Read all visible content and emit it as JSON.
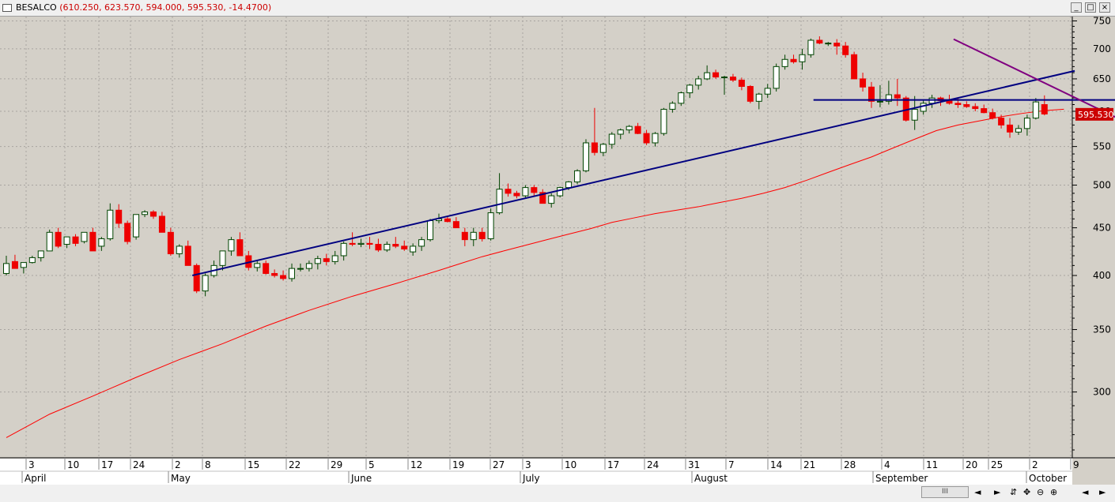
{
  "window": {
    "symbol": "BESALCO",
    "values": "(610.250, 623.570, 594.000, 595.530, -14.4700)",
    "buttons": [
      "_",
      "□",
      "×"
    ]
  },
  "colors": {
    "up_fill": "#ffffff",
    "up_stroke": "#004400",
    "down": "#ee0000",
    "ma": "#ff0000",
    "trend": "#000080",
    "down_trend": "#800080",
    "bg": "#d4d0c8",
    "price_box": "#cc0000"
  },
  "scrollbar": {
    "thumb_label": "III",
    "icons": [
      "◄",
      "►",
      "⇵",
      "✥",
      "⊖",
      "⊕",
      "◄",
      "►"
    ]
  },
  "chart_data": {
    "type": "candlestick",
    "y_axis": {
      "scale": "log",
      "range": [
        255,
        770
      ],
      "ticks": [
        300,
        350,
        400,
        450,
        500,
        550,
        600,
        650,
        700,
        750
      ]
    },
    "last_price_label": "595.530",
    "day_labels": [
      "3",
      "10",
      "17",
      "24",
      "2",
      "8",
      "15",
      "22",
      "29",
      "5",
      "12",
      "19",
      "27",
      "3",
      "10",
      "17",
      "24",
      "31",
      "7",
      "14",
      "21",
      "28",
      "4",
      "11",
      "20",
      "25",
      "2",
      "9"
    ],
    "month_labels": [
      "April",
      "May",
      "June",
      "July",
      "August",
      "September",
      "October"
    ],
    "candles": [
      [
        402,
        420,
        400,
        412
      ],
      [
        414,
        421,
        407,
        407
      ],
      [
        408,
        413,
        402,
        413
      ],
      [
        413,
        420,
        412,
        418
      ],
      [
        418,
        425,
        414,
        425
      ],
      [
        425,
        448,
        425,
        445
      ],
      [
        445,
        450,
        428,
        430
      ],
      [
        432,
        440,
        428,
        440
      ],
      [
        440,
        443,
        430,
        433
      ],
      [
        435,
        445,
        433,
        445
      ],
      [
        445,
        450,
        425,
        425
      ],
      [
        430,
        440,
        425,
        438
      ],
      [
        438,
        478,
        436,
        470
      ],
      [
        470,
        477,
        450,
        455
      ],
      [
        455,
        458,
        432,
        435
      ],
      [
        440,
        465,
        437,
        465
      ],
      [
        465,
        470,
        462,
        468
      ],
      [
        468,
        470,
        460,
        463
      ],
      [
        463,
        468,
        445,
        445
      ],
      [
        445,
        450,
        420,
        422
      ],
      [
        422,
        432,
        418,
        430
      ],
      [
        430,
        436,
        410,
        410
      ],
      [
        410,
        412,
        383,
        385
      ],
      [
        385,
        402,
        380,
        400
      ],
      [
        400,
        415,
        398,
        410
      ],
      [
        410,
        425,
        405,
        425
      ],
      [
        425,
        440,
        420,
        437
      ],
      [
        437,
        445,
        420,
        420
      ],
      [
        420,
        425,
        405,
        408
      ],
      [
        408,
        415,
        404,
        412
      ],
      [
        412,
        415,
        401,
        402
      ],
      [
        402,
        406,
        398,
        400
      ],
      [
        400,
        405,
        395,
        397
      ],
      [
        397,
        412,
        394,
        407
      ],
      [
        407,
        412,
        404,
        407
      ],
      [
        407,
        415,
        404,
        412
      ],
      [
        412,
        420,
        406,
        417
      ],
      [
        417,
        422,
        410,
        414
      ],
      [
        414,
        425,
        411,
        420
      ],
      [
        420,
        435,
        415,
        433
      ],
      [
        433,
        445,
        430,
        432
      ],
      [
        432,
        438,
        429,
        433
      ],
      [
        433,
        440,
        427,
        432
      ],
      [
        432,
        438,
        424,
        426
      ],
      [
        426,
        435,
        424,
        432
      ],
      [
        432,
        440,
        428,
        430
      ],
      [
        430,
        436,
        425,
        427
      ],
      [
        424,
        433,
        420,
        430
      ],
      [
        430,
        440,
        425,
        437
      ],
      [
        437,
        460,
        435,
        458
      ],
      [
        458,
        466,
        455,
        460
      ],
      [
        460,
        463,
        456,
        457
      ],
      [
        457,
        462,
        450,
        450
      ],
      [
        445,
        450,
        430,
        437
      ],
      [
        437,
        450,
        430,
        445
      ],
      [
        445,
        450,
        435,
        438
      ],
      [
        438,
        472,
        436,
        467
      ],
      [
        467,
        515,
        465,
        495
      ],
      [
        495,
        502,
        486,
        490
      ],
      [
        490,
        493,
        484,
        487
      ],
      [
        487,
        500,
        485,
        497
      ],
      [
        497,
        500,
        486,
        491
      ],
      [
        491,
        495,
        478,
        478
      ],
      [
        478,
        490,
        473,
        487
      ],
      [
        487,
        498,
        485,
        497
      ],
      [
        497,
        505,
        494,
        504
      ],
      [
        504,
        520,
        501,
        518
      ],
      [
        518,
        560,
        516,
        555
      ],
      [
        555,
        605,
        538,
        542
      ],
      [
        542,
        555,
        537,
        553
      ],
      [
        553,
        570,
        547,
        567
      ],
      [
        567,
        575,
        560,
        573
      ],
      [
        573,
        580,
        568,
        578
      ],
      [
        578,
        583,
        567,
        568
      ],
      [
        568,
        573,
        552,
        555
      ],
      [
        555,
        570,
        550,
        568
      ],
      [
        568,
        605,
        565,
        603
      ],
      [
        603,
        615,
        598,
        612
      ],
      [
        612,
        630,
        608,
        628
      ],
      [
        628,
        642,
        620,
        640
      ],
      [
        640,
        655,
        633,
        650
      ],
      [
        650,
        672,
        648,
        660
      ],
      [
        660,
        665,
        650,
        653
      ],
      [
        653,
        655,
        625,
        653
      ],
      [
        653,
        658,
        645,
        648
      ],
      [
        648,
        652,
        632,
        638
      ],
      [
        638,
        640,
        612,
        615
      ],
      [
        615,
        628,
        603,
        626
      ],
      [
        626,
        642,
        620,
        635
      ],
      [
        635,
        675,
        630,
        670
      ],
      [
        670,
        690,
        665,
        682
      ],
      [
        682,
        690,
        675,
        678
      ],
      [
        678,
        700,
        665,
        690
      ],
      [
        690,
        718,
        685,
        715
      ],
      [
        715,
        722,
        708,
        710
      ],
      [
        710,
        712,
        705,
        710
      ],
      [
        710,
        717,
        690,
        705
      ],
      [
        705,
        712,
        685,
        690
      ],
      [
        690,
        695,
        650,
        650
      ],
      [
        650,
        660,
        630,
        637
      ],
      [
        637,
        645,
        605,
        615
      ],
      [
        615,
        640,
        606,
        615
      ],
      [
        615,
        647,
        610,
        625
      ],
      [
        625,
        650,
        608,
        620
      ],
      [
        620,
        623,
        585,
        587
      ],
      [
        587,
        623,
        573,
        603
      ],
      [
        600,
        618,
        595,
        612
      ],
      [
        612,
        625,
        605,
        620
      ],
      [
        620,
        622,
        608,
        616
      ],
      [
        616,
        625,
        610,
        612
      ],
      [
        612,
        620,
        605,
        610
      ],
      [
        610,
        615,
        605,
        607
      ],
      [
        607,
        612,
        600,
        604
      ],
      [
        604,
        610,
        597,
        598
      ],
      [
        598,
        604,
        588,
        590
      ],
      [
        590,
        595,
        575,
        580
      ],
      [
        580,
        590,
        562,
        570
      ],
      [
        570,
        580,
        566,
        575
      ],
      [
        575,
        595,
        565,
        590
      ],
      [
        590,
        620,
        588,
        614
      ],
      [
        610,
        624,
        594,
        596
      ]
    ],
    "moving_average": [
      [
        0,
        268
      ],
      [
        20,
        284
      ],
      [
        40,
        297
      ],
      [
        60,
        311
      ],
      [
        80,
        325
      ],
      [
        100,
        338
      ],
      [
        120,
        353
      ],
      [
        140,
        367
      ],
      [
        160,
        380
      ],
      [
        180,
        392
      ],
      [
        200,
        405
      ],
      [
        210,
        412
      ],
      [
        220,
        419
      ],
      [
        230,
        425
      ],
      [
        240,
        431
      ],
      [
        250,
        437
      ],
      [
        260,
        443
      ],
      [
        270,
        449
      ],
      [
        280,
        456
      ],
      [
        290,
        461
      ],
      [
        300,
        466
      ],
      [
        310,
        470
      ],
      [
        320,
        474
      ],
      [
        330,
        479
      ],
      [
        340,
        484
      ],
      [
        350,
        490
      ],
      [
        360,
        497
      ],
      [
        370,
        506
      ],
      [
        380,
        516
      ],
      [
        390,
        526
      ],
      [
        400,
        536
      ],
      [
        410,
        548
      ],
      [
        420,
        560
      ],
      [
        430,
        572
      ],
      [
        440,
        580
      ],
      [
        450,
        586
      ],
      [
        460,
        592
      ],
      [
        470,
        597
      ],
      [
        480,
        601
      ],
      [
        489,
        603
      ]
    ],
    "trendlines": [
      {
        "name": "uptrend",
        "color": "trend",
        "points": [
          [
            21.5,
            400
          ],
          [
            123.5,
            663
          ]
        ]
      },
      {
        "name": "resistance",
        "color": "trend",
        "points": [
          [
            93.3,
            617
          ],
          [
            131,
            617
          ]
        ]
      },
      {
        "name": "downtrend",
        "color": "down_trend",
        "points": [
          [
            109.5,
            717
          ],
          [
            133.5,
            560
          ]
        ]
      }
    ]
  }
}
